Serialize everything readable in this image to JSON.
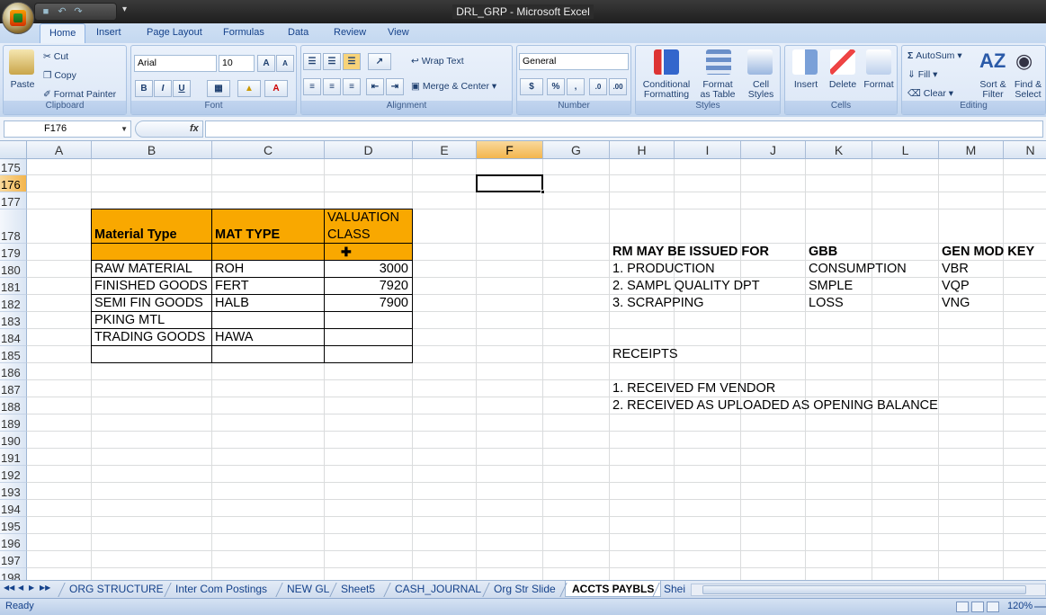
{
  "window": {
    "title": "DRL_GRP - Microsoft Excel"
  },
  "ribbon": {
    "tabs": [
      "Home",
      "Insert",
      "Page Layout",
      "Formulas",
      "Data",
      "Review",
      "View"
    ],
    "clipboard": {
      "paste": "Paste",
      "cut": "Cut",
      "copy": "Copy",
      "format_painter": "Format Painter",
      "label": "Clipboard"
    },
    "font": {
      "name": "Arial",
      "size": "10",
      "bold": "B",
      "italic": "I",
      "underline": "U",
      "label": "Font"
    },
    "alignment": {
      "wrap_text": "Wrap Text",
      "merge_center": "Merge & Center",
      "label": "Alignment"
    },
    "number": {
      "format": "General",
      "currency": "$",
      "percent": "%",
      "comma": ",",
      "label": "Number"
    },
    "styles": {
      "conditional": "Conditional",
      "conditional2": "Formatting",
      "format_as": "Format",
      "format_as2": "as Table",
      "cell": "Cell",
      "cell2": "Styles",
      "label": "Styles"
    },
    "cells": {
      "insert": "Insert",
      "delete": "Delete",
      "format": "Format",
      "label": "Cells"
    },
    "editing": {
      "autosum": "AutoSum",
      "fill": "Fill",
      "clear": "Clear",
      "sort": "Sort &",
      "sort2": "Filter",
      "find": "Find &",
      "find2": "Select",
      "label": "Editing"
    }
  },
  "formula_bar": {
    "name_box": "F176",
    "fx": "fx",
    "value": ""
  },
  "columns": [
    "A",
    "B",
    "C",
    "D",
    "E",
    "F",
    "G",
    "H",
    "I",
    "J",
    "K",
    "L",
    "M",
    "N"
  ],
  "rows": [
    "175",
    "176",
    "177",
    "178",
    "179",
    "180",
    "181",
    "182",
    "183",
    "184",
    "185",
    "186",
    "187",
    "188",
    "189",
    "190",
    "191",
    "192",
    "193",
    "194",
    "195",
    "196",
    "197",
    "198"
  ],
  "table": {
    "headers": [
      "Material Type",
      "MAT TYPE",
      "VALUATION",
      "CLASS"
    ],
    "rows": [
      [
        "RAW MATERIAL",
        "ROH",
        "3000"
      ],
      [
        "FINISHED GOODS",
        "FERT",
        "7920"
      ],
      [
        "SEMI FIN GOODS",
        "HALB",
        "7900"
      ],
      [
        "PKING MTL",
        "",
        ""
      ],
      [
        "TRADING GOODS",
        "HAWA",
        ""
      ]
    ]
  },
  "notes": {
    "issue_header": "RM MAY BE ISSUED  FOR",
    "gbb_header": "GBB",
    "key_header": "GEN MOD KEY",
    "items": [
      [
        "1. PRODUCTION",
        "CONSUMPTION",
        "VBR"
      ],
      [
        "2. SAMPL QUALITY DPT",
        "SMPLE",
        "VQP"
      ],
      [
        "3. SCRAPPING",
        "LOSS",
        "VNG"
      ]
    ],
    "receipts": "RECEIPTS",
    "receipt_items": [
      "1. RECEIVED FM VENDOR",
      "2. RECEIVED AS UPLOADED AS OPENING BALANCE"
    ]
  },
  "sheet_tabs": [
    "ORG STRUCTURE",
    "Inter Com Postings",
    "NEW GL",
    "Sheet5",
    "CASH_JOURNAL",
    "Org Str Slide",
    "ACCTS PAYBLS",
    "Shei"
  ],
  "status": {
    "text": "Ready",
    "zoom": "120%"
  },
  "colors": {
    "header_fill": "#f9a800",
    "selected_header": "#f3b54d"
  }
}
